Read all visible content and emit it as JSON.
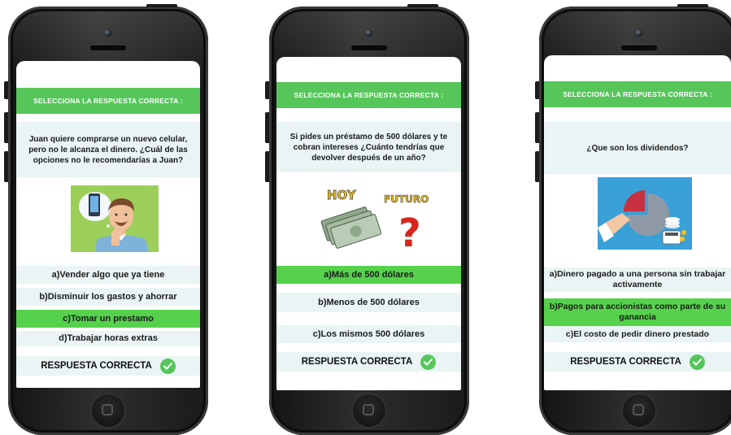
{
  "accent_color": "#56c65a",
  "selected_color": "#56d14c",
  "phones": [
    {
      "header": "SELECCIONA LA RESPUESTA CORRECTA :",
      "question": "Juan quiere comprarse un nuevo celular, pero no le alcanza el dinero. ¿Cuál de las opciones no le recomendarías a Juan?",
      "image_icon": "man-thinking-about-phone-illustration",
      "options": [
        "a)Vender algo que ya tiene",
        "b)Disminuir los gastos y ahorrar",
        "c)Tomar un prestamo",
        "d)Trabajar horas extras"
      ],
      "selected_option": 2,
      "answer_label": "RESPUESTA CORRECTA",
      "answer_icon": "check-circle-icon"
    },
    {
      "header": "SELECCIONA LA RESPUESTA CORRECTA :",
      "question": "Si pides un préstamo de 500 dólares y te cobran intereses ¿Cuánto tendrías que devolver después de un año?",
      "image_icon": "money-stack-question-illustration",
      "image_labels": [
        "HOY",
        "FUTURO"
      ],
      "options": [
        "a)Más de 500 dólares",
        "b)Menos de 500 dólares",
        "c)Los mismos 500 dólares"
      ],
      "selected_option": 0,
      "answer_label": "RESPUESTA CORRECTA",
      "answer_icon": "check-circle-icon"
    },
    {
      "header": "SELECCIONA LA RESPUESTA CORRECTA :",
      "question": "¿Que son los dividendos?",
      "image_icon": "pie-chart-coins-illustration",
      "options": [
        "a)Dinero pagado a una persona sin trabajar activamente",
        "b)Pagos para accionistas como parte de su ganancia",
        "c)El costo de pedir dinero prestado"
      ],
      "selected_option": 1,
      "answer_label": "RESPUESTA CORRECTA",
      "answer_icon": "check-circle-icon"
    }
  ]
}
